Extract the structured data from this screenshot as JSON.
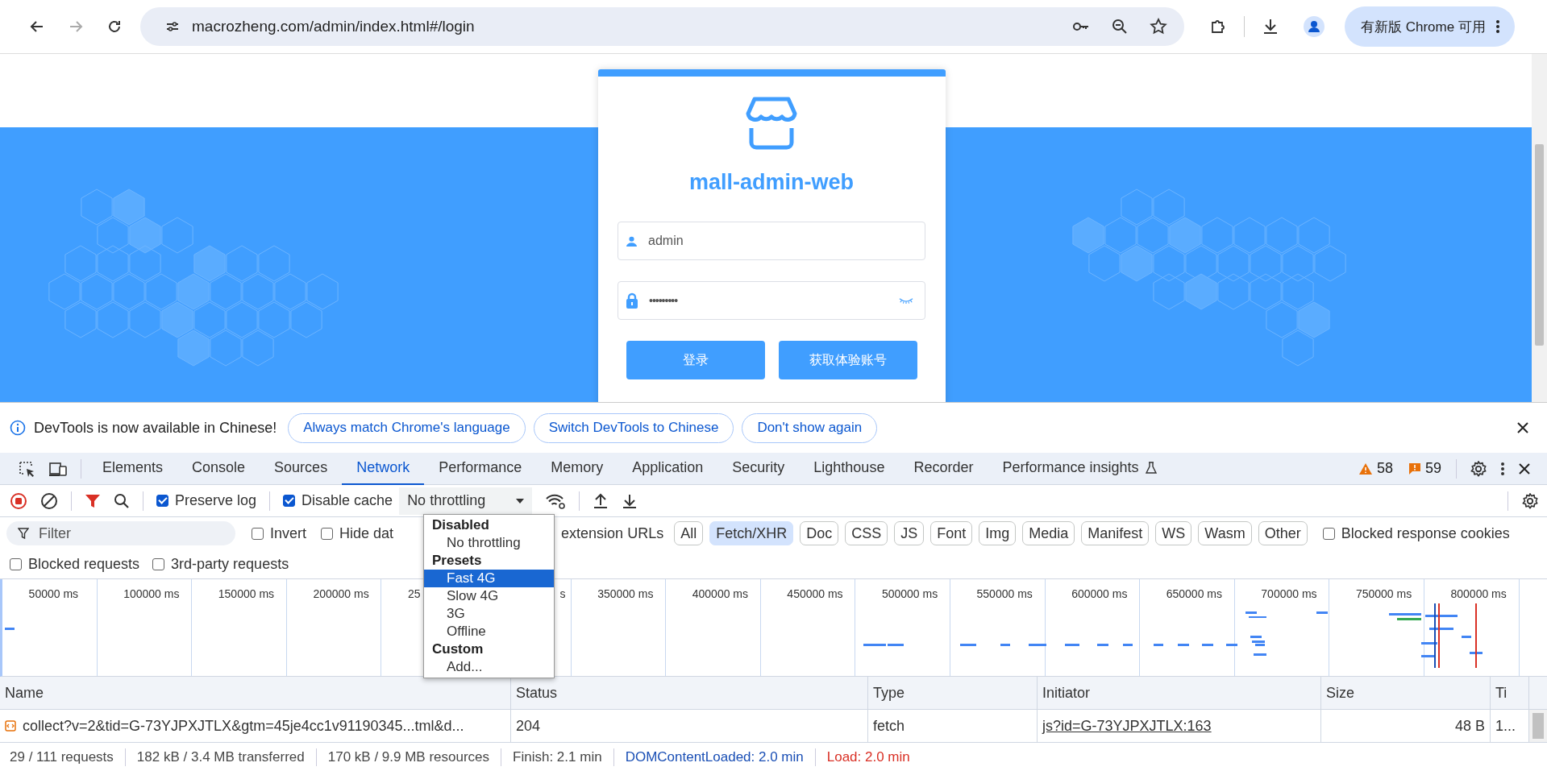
{
  "browser": {
    "address": "macrozheng.com/admin/index.html#/login",
    "update_button": "有新版 Chrome 可用"
  },
  "page": {
    "title": "mall-admin-web",
    "username": "admin",
    "password": "•••••••••",
    "buttons": [
      "登录",
      "获取体验账号"
    ]
  },
  "infobar": {
    "message": "DevTools is now available in Chinese!",
    "buttons": [
      "Always match Chrome's language",
      "Switch DevTools to Chinese",
      "Don't show again"
    ]
  },
  "devtools": {
    "tabs": [
      {
        "label": "Elements",
        "selected": false
      },
      {
        "label": "Console",
        "selected": false
      },
      {
        "label": "Sources",
        "selected": false
      },
      {
        "label": "Network",
        "selected": true
      },
      {
        "label": "Performance",
        "selected": false
      },
      {
        "label": "Memory",
        "selected": false
      },
      {
        "label": "Application",
        "selected": false
      },
      {
        "label": "Security",
        "selected": false
      },
      {
        "label": "Lighthouse",
        "selected": false
      },
      {
        "label": "Recorder",
        "selected": false
      },
      {
        "label": "Performance insights",
        "selected": false
      }
    ],
    "warnings": "58",
    "issues": "59"
  },
  "toolbar": {
    "recording": true,
    "checkboxes": [
      {
        "label": "Preserve log",
        "checked": true
      },
      {
        "label": "Disable cache",
        "checked": true
      }
    ],
    "throttling": "No throttling"
  },
  "filter": {
    "placeholder": "Filter",
    "checkboxes": [
      {
        "label": "Invert",
        "checked": false
      },
      {
        "label": "Hide dat",
        "checked": false
      }
    ],
    "cut_label": "extension URLs",
    "chips": [
      {
        "label": "All",
        "selected": false
      },
      {
        "label": "Fetch/XHR",
        "selected": true
      },
      {
        "label": "Doc",
        "selected": false
      },
      {
        "label": "CSS",
        "selected": false
      },
      {
        "label": "JS",
        "selected": false
      },
      {
        "label": "Font",
        "selected": false
      },
      {
        "label": "Img",
        "selected": false
      },
      {
        "label": "Media",
        "selected": false
      },
      {
        "label": "Manifest",
        "selected": false
      },
      {
        "label": "WS",
        "selected": false
      },
      {
        "label": "Wasm",
        "selected": false
      },
      {
        "label": "Other",
        "selected": false
      }
    ],
    "blocked_cookies": {
      "label": "Blocked response cookies",
      "checked": false
    },
    "second_row": [
      {
        "label": "Blocked requests",
        "checked": false
      },
      {
        "label": "3rd-party requests",
        "checked": false
      }
    ]
  },
  "timeline": {
    "ticks": [
      "50000 ms",
      "100000 ms",
      "150000 ms",
      "200000 ms",
      "25",
      "s",
      "350000 ms",
      "400000 ms",
      "450000 ms",
      "500000 ms",
      "550000 ms",
      "600000 ms",
      "650000 ms",
      "700000 ms",
      "750000 ms",
      "800000 ms"
    ]
  },
  "throttle_menu": {
    "groups": [
      {
        "title": "Disabled",
        "options": [
          {
            "label": "No throttling",
            "selected": false
          }
        ]
      },
      {
        "title": "Presets",
        "options": [
          {
            "label": "Fast 4G",
            "selected": true
          },
          {
            "label": "Slow 4G",
            "selected": false
          },
          {
            "label": "3G",
            "selected": false
          },
          {
            "label": "Offline",
            "selected": false
          }
        ]
      },
      {
        "title": "Custom",
        "options": [
          {
            "label": "Add...",
            "selected": false
          }
        ]
      }
    ]
  },
  "table": {
    "columns": [
      "Name",
      "Status",
      "Type",
      "Initiator",
      "Size",
      "Ti"
    ],
    "rows": [
      {
        "name": "collect?v=2&tid=G-73YJPXJTLX&gtm=45je4cc1v91190345...tml&d...",
        "status": "204",
        "type": "fetch",
        "initiator": "js?id=G-73YJPXJTLX:163",
        "size": "48 B",
        "time": "1..."
      }
    ]
  },
  "status_bar": [
    {
      "text": "29 / 111 requests",
      "color": "#474747"
    },
    {
      "text": "182 kB / 3.4 MB transferred",
      "color": "#474747"
    },
    {
      "text": "170 kB / 9.9 MB resources",
      "color": "#474747"
    },
    {
      "text": "Finish: 2.1 min",
      "color": "#474747"
    },
    {
      "text": "DOMContentLoaded: 2.0 min",
      "color": "#1a4fb5"
    },
    {
      "text": "Load: 2.0 min",
      "color": "#d93025"
    }
  ]
}
